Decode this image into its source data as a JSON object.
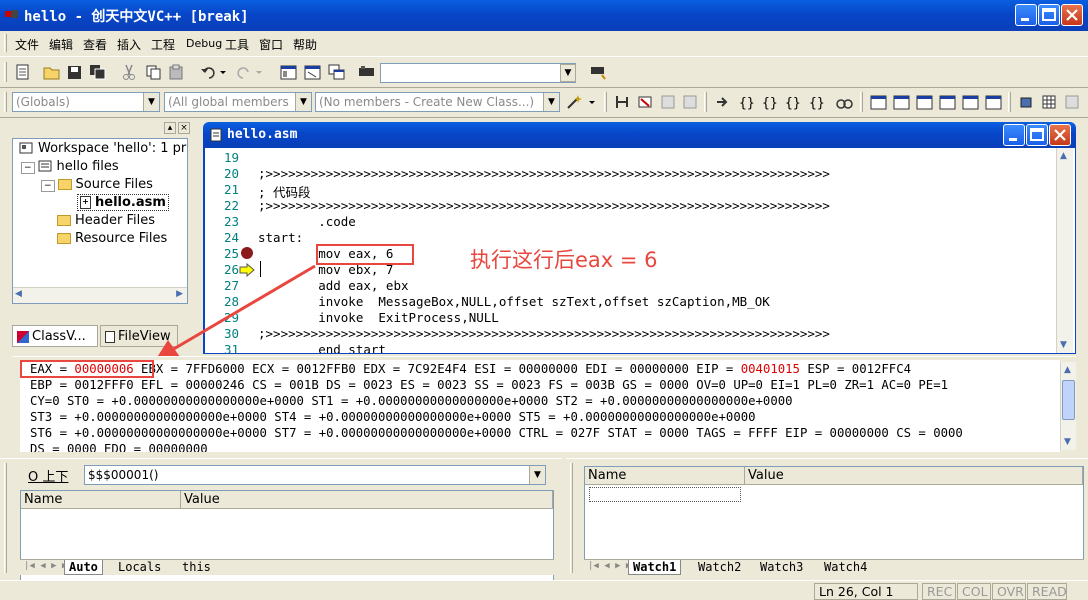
{
  "window": {
    "title": "hello - 创天中文VC++ [break]"
  },
  "menu": [
    "文件",
    "编辑",
    "查看",
    "插入",
    "工程",
    "Debug",
    "工具",
    "窗口",
    "帮助"
  ],
  "toolbar": {
    "find_combo_value": ""
  },
  "wizard": {
    "class_combo": "(Globals)",
    "filter_combo": "(All global members",
    "members_combo": "(No members - Create New Class...)"
  },
  "workspace": {
    "tree": [
      "Workspace 'hello': 1 pr",
      "hello files",
      "Source Files",
      "hello.asm",
      "Header Files",
      "Resource Files"
    ],
    "tabs": [
      "ClassV...",
      "FileView"
    ]
  },
  "editor": {
    "title": "hello.asm",
    "lines": [
      {
        "n": "19",
        "t": ""
      },
      {
        "n": "20",
        "t": ";>>>>>>>>>>>>>>>>>>>>>>>>>>>>>>>>>>>>>>>>>>>>>>>>>>>>>>>>>>>>>>>>>>>>>>>>>>>"
      },
      {
        "n": "21",
        "t": "; 代码段"
      },
      {
        "n": "22",
        "t": ";>>>>>>>>>>>>>>>>>>>>>>>>>>>>>>>>>>>>>>>>>>>>>>>>>>>>>>>>>>>>>>>>>>>>>>>>>>>"
      },
      {
        "n": "23",
        "t": "        .code"
      },
      {
        "n": "24",
        "t": "start:"
      },
      {
        "n": "25",
        "t": "        mov eax, 6"
      },
      {
        "n": "26",
        "t": "        mov ebx, 7"
      },
      {
        "n": "27",
        "t": "        add eax, ebx"
      },
      {
        "n": "28",
        "t": "        invoke  MessageBox,NULL,offset szText,offset szCaption,MB_OK"
      },
      {
        "n": "29",
        "t": "        invoke  ExitProcess,NULL"
      },
      {
        "n": "30",
        "t": ";>>>>>>>>>>>>>>>>>>>>>>>>>>>>>>>>>>>>>>>>>>>>>>>>>>>>>>>>>>>>>>>>>>>>>>>>>>>"
      },
      {
        "n": "31",
        "t": "        end start"
      }
    ],
    "annotation": "执行这行后eax = 6"
  },
  "registers": {
    "eax_label": "EAX = ",
    "eax_value": "00000006",
    "line1_rest_a": " EBX = 7FFD6000 ECX = 0012FFB0 EDX = 7C92E4F4 ESI = 00000000 EDI = 00000000 EIP = ",
    "eip_value": "00401015",
    "line1_rest_b": " ESP = 0012FFC4",
    "line2": "EBP = 0012FFF0 EFL = 00000246 CS = 001B DS = 0023 ES = 0023 SS = 0023 FS = 003B GS = 0000 OV=0 UP=0 EI=1 PL=0 ZR=1 AC=0 PE=1",
    "line3": "CY=0 ST0 = +0.00000000000000000e+0000 ST1 = +0.00000000000000000e+0000 ST2 = +0.00000000000000000e+0000",
    "line4": "ST3 = +0.00000000000000000e+0000 ST4 = +0.00000000000000000e+0000 ST5 = +0.00000000000000000e+0000",
    "line5": "ST6 = +0.00000000000000000e+0000 ST7 = +0.00000000000000000e+0000 CTRL = 027F STAT = 0000 TAGS = FFFF EIP = 00000000 CS = 0000",
    "line6": "DS = 0000 EDO = 00000000"
  },
  "variables": {
    "context_label": "O 上下",
    "context_value": "$$$00001()",
    "col_name": "Name",
    "col_value": "Value",
    "tabs": [
      "Auto",
      "Locals",
      "this"
    ]
  },
  "watch": {
    "col_name": "Name",
    "col_value": "Value",
    "tabs": [
      "Watch1",
      "Watch2",
      "Watch3",
      "Watch4"
    ]
  },
  "statusbar": {
    "position": "Ln 26, Col 1",
    "indicators": [
      "REC",
      "COL",
      "OVR",
      "READ"
    ]
  }
}
